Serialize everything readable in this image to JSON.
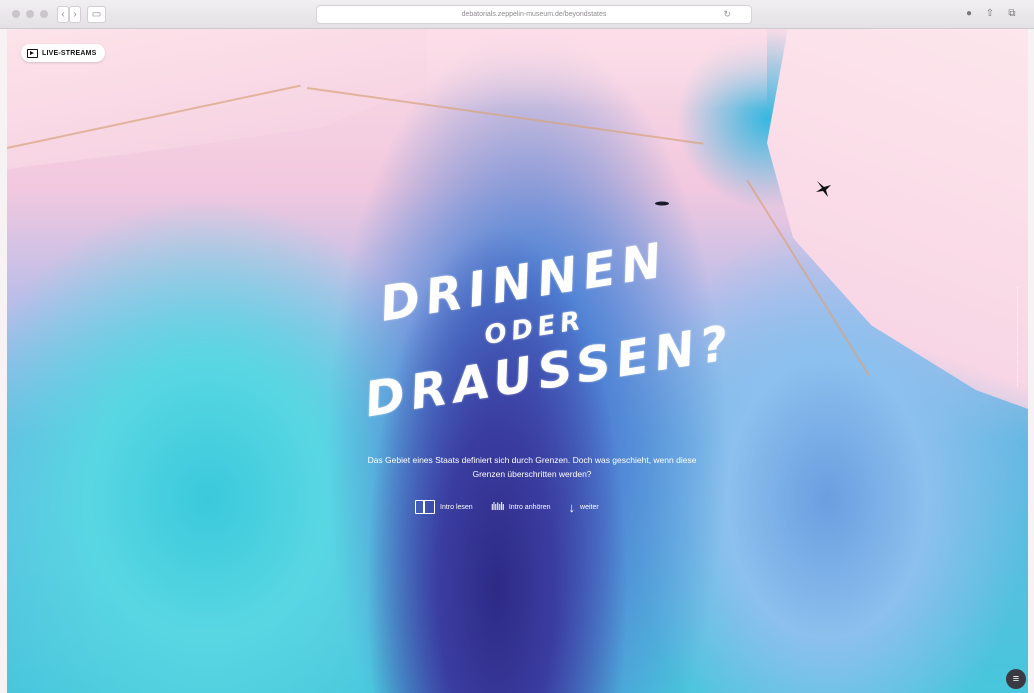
{
  "browser": {
    "back_glyph": "‹",
    "forward_glyph": "›",
    "sidebar_glyph": "▭",
    "url": "debatorials.zeppelin-museum.de/beyondstates",
    "reload_glyph": "↻",
    "download_glyph": "●",
    "share_glyph": "⇧",
    "tabs_glyph": "⧉"
  },
  "page": {
    "live_streams_label": "LIVE-STREAMS",
    "title_line1": "DRINNEN",
    "title_line2": "ODER",
    "title_line3": "DRAUSSEN?",
    "intro_text": "Das Gebiet eines Staats definiert sich durch Grenzen. Doch was geschieht, wenn diese Grenzen überschritten werden?",
    "actions": {
      "read_label": "Intro lesen",
      "listen_label": "Intro anhören",
      "next_label": "weiter",
      "listen_glyph": "ılıIılı",
      "next_glyph": "↓"
    },
    "menu_glyph": "≡"
  },
  "colors": {
    "accent_text": "#ffffff",
    "deep_channel": "#2e2a86",
    "cyan_shelf": "#3ac9dc",
    "pink_land": "#f7d4e3"
  }
}
